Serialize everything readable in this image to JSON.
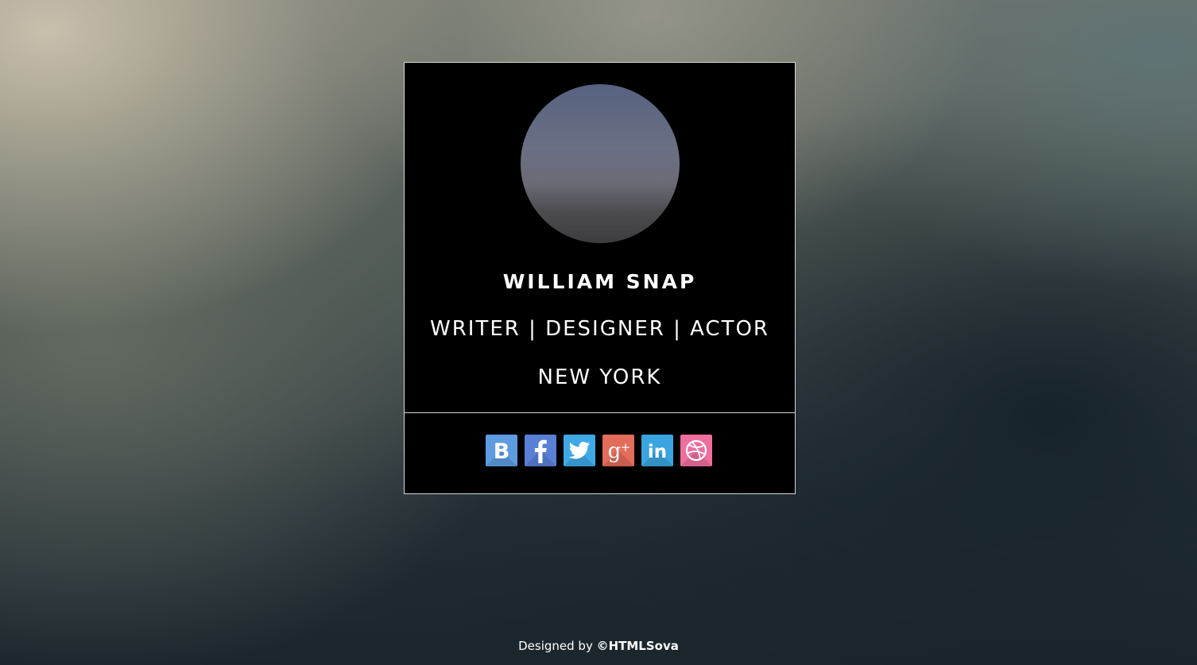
{
  "profile": {
    "name": "WILLIAM SNAP",
    "roles": "WRITER | DESIGNER | ACTOR",
    "city": "NEW YORK"
  },
  "social": [
    {
      "network": "vk",
      "icon": "vk-icon",
      "glyph": "B",
      "color": "#5e9be0"
    },
    {
      "network": "facebook",
      "icon": "facebook-icon",
      "glyph": "f",
      "color": "#5a80d6"
    },
    {
      "network": "twitter",
      "icon": "twitter-icon",
      "glyph": "bird",
      "color": "#3fa9e6"
    },
    {
      "network": "google-plus",
      "icon": "google-plus-icon",
      "glyph": "g+",
      "color": "#e36c5b"
    },
    {
      "network": "linkedin",
      "icon": "linkedin-icon",
      "glyph": "in",
      "color": "#3aa4e0"
    },
    {
      "network": "dribbble",
      "icon": "dribbble-icon",
      "glyph": "ball",
      "color": "#ee6f9e"
    }
  ],
  "footer": {
    "prefix": "Designed by ",
    "brand": "©HTMLSova"
  }
}
